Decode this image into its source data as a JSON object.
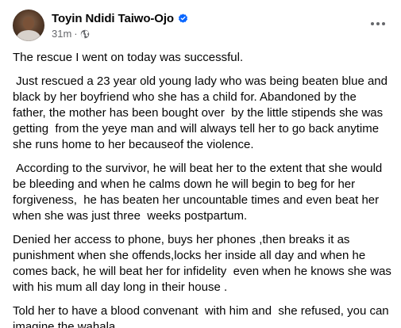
{
  "post": {
    "author": "Toyin Ndidi Taiwo-Ojo",
    "time": "31m",
    "separator": "·",
    "audience_icon": "globe-icon",
    "verified_icon": "verified-badge-icon",
    "verified_color": "#0866ff",
    "more_icon": "more-options-icon",
    "paragraphs": [
      "The rescue I went on today was successful.",
      " Just rescued a 23 year old young lady who was being beaten blue and black by her boyfriend who she has a child for. Abandoned by the father, the mother has been bought over  by the little stipends she was getting  from the yeye man and will always tell her to go back anytime she runs home to her becauseof the violence.",
      " According to the survivor, he will beat her to the extent that she would be bleeding and when he calms down he will begin to beg for her forgiveness,  he has beaten her uncountable times and even beat her when she was just three  weeks postpartum.",
      "Denied her access to phone, buys her phones ,then breaks it as punishment when she offends,locks her inside all day and when he comes back, he will beat her for infidelity  even when he knows she was with his mum all day long in their house .",
      "Told her to have a blood convenant  with him and  she refused, you can imagine the wahala."
    ]
  }
}
